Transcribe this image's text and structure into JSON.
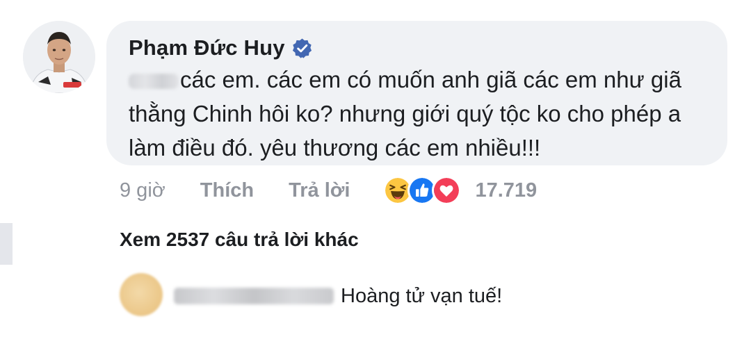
{
  "comment": {
    "author_name": "Phạm Đức Huy",
    "text": "các em. các em có muốn anh giã các em như giã thằng Chinh hôi ko? nhưng giới quý tộc ko cho phép a làm điều đó. yêu thương các em nhiều!!!"
  },
  "actions": {
    "timestamp": "9 giờ",
    "like_label": "Thích",
    "reply_label": "Trả lời",
    "reaction_count": "17.719",
    "reactions": [
      "haha-icon",
      "like-icon",
      "love-icon"
    ]
  },
  "view_more_replies": "Xem 2537 câu trả lời khác",
  "reply": {
    "text": "Hoàng tử vạn tuế!"
  },
  "colors": {
    "bubble_bg": "#f0f2f5",
    "muted_text": "#90949c",
    "primary_text": "#1c1e21",
    "verified_blue": "#4267b2",
    "like_blue": "#1877f2",
    "love_red": "#f33e58",
    "haha_yellow": "#fcc642"
  }
}
